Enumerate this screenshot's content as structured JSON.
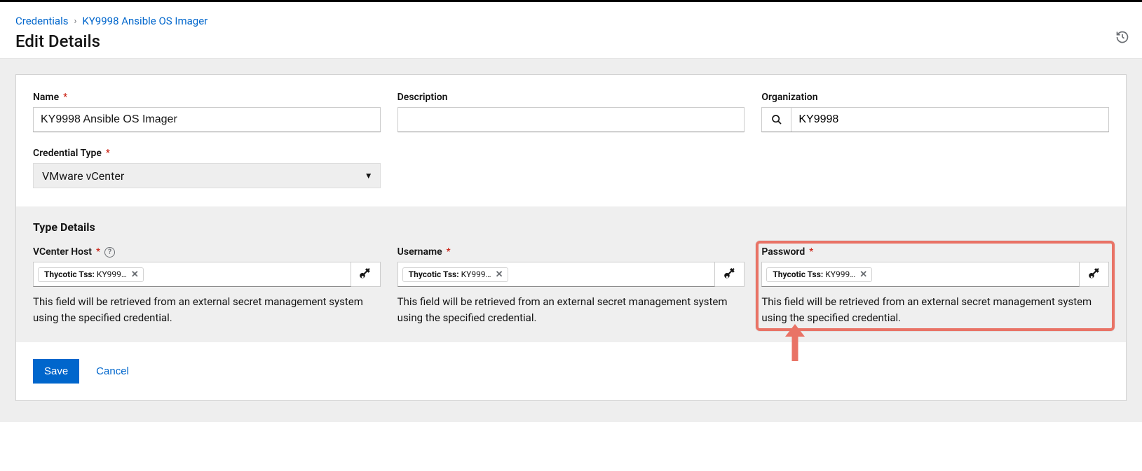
{
  "breadcrumbs": {
    "root": "Credentials",
    "current": "KY9998 Ansible OS Imager"
  },
  "page_title": "Edit Details",
  "form": {
    "name_label": "Name",
    "name_value": "KY9998 Ansible OS Imager",
    "description_label": "Description",
    "description_value": "",
    "organization_label": "Organization",
    "organization_value": "KY9998",
    "credential_type_label": "Credential Type",
    "credential_type_value": "VMware vCenter"
  },
  "type_details": {
    "heading": "Type Details",
    "vcenter_host_label": "VCenter Host",
    "username_label": "Username",
    "password_label": "Password",
    "chip_prefix": "Thycotic Tss:",
    "chip_value": " KY999…",
    "helper": "This field will be retrieved from an external secret management system using the specified credential."
  },
  "actions": {
    "save": "Save",
    "cancel": "Cancel"
  }
}
